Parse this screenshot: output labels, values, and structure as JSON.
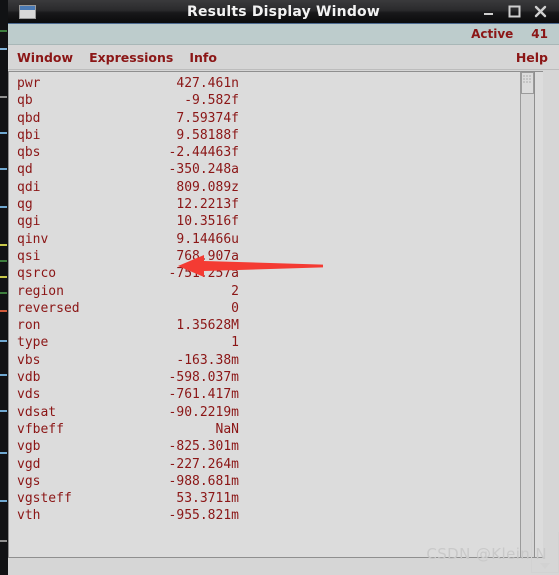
{
  "window": {
    "title": "Results Display Window",
    "icon": "window-icon",
    "buttons": [
      {
        "name": "minimize-button",
        "glyph": "minimize-icon"
      },
      {
        "name": "maximize-button",
        "glyph": "maximize-icon"
      },
      {
        "name": "close-button",
        "glyph": "close-icon"
      }
    ]
  },
  "status_strip": {
    "state_label": "Active",
    "count": "41"
  },
  "menu_bar": {
    "items": [
      {
        "label": "Window"
      },
      {
        "label": "Expressions"
      },
      {
        "label": "Info"
      }
    ],
    "help_label": "Help"
  },
  "results": {
    "rows": [
      {
        "name": "pwr",
        "value": "427.461n"
      },
      {
        "name": "qb",
        "value": "-9.582f"
      },
      {
        "name": "qbd",
        "value": "7.59374f"
      },
      {
        "name": "qbi",
        "value": "9.58188f"
      },
      {
        "name": "qbs",
        "value": "-2.44463f"
      },
      {
        "name": "qd",
        "value": "-350.248a"
      },
      {
        "name": "qdi",
        "value": "809.089z"
      },
      {
        "name": "qg",
        "value": "12.2213f"
      },
      {
        "name": "qgi",
        "value": "10.3516f"
      },
      {
        "name": "qinv",
        "value": "9.14466u"
      },
      {
        "name": "qsi",
        "value": "768.907a"
      },
      {
        "name": "qsrco",
        "value": "-751.257a"
      },
      {
        "name": "region",
        "value": "2"
      },
      {
        "name": "reversed",
        "value": "0"
      },
      {
        "name": "ron",
        "value": "1.35628M"
      },
      {
        "name": "type",
        "value": "1"
      },
      {
        "name": "vbs",
        "value": "-163.38m"
      },
      {
        "name": "vdb",
        "value": "-598.037m"
      },
      {
        "name": "vds",
        "value": "-761.417m"
      },
      {
        "name": "vdsat",
        "value": "-90.2219m"
      },
      {
        "name": "vfbeff",
        "value": "NaN"
      },
      {
        "name": "vgb",
        "value": "-825.301m"
      },
      {
        "name": "vgd",
        "value": "-227.264m"
      },
      {
        "name": "vgs",
        "value": "-988.681m"
      },
      {
        "name": "vgsteff",
        "value": "53.3711m"
      },
      {
        "name": "vth",
        "value": "-955.821m"
      }
    ]
  },
  "annotation": {
    "name": "red-arrow-pointing-to-region-row",
    "color": "#f43b33",
    "points_to": "region"
  },
  "watermark": {
    "text": "CSDN @Klein N"
  },
  "colors": {
    "title_bar": "#18181a",
    "status_strip": "#bdcccc",
    "menu_text": "#8b1616",
    "content_bg": "#dcdcdc",
    "value_text": "#8b1616",
    "arrow": "#f43b33"
  }
}
